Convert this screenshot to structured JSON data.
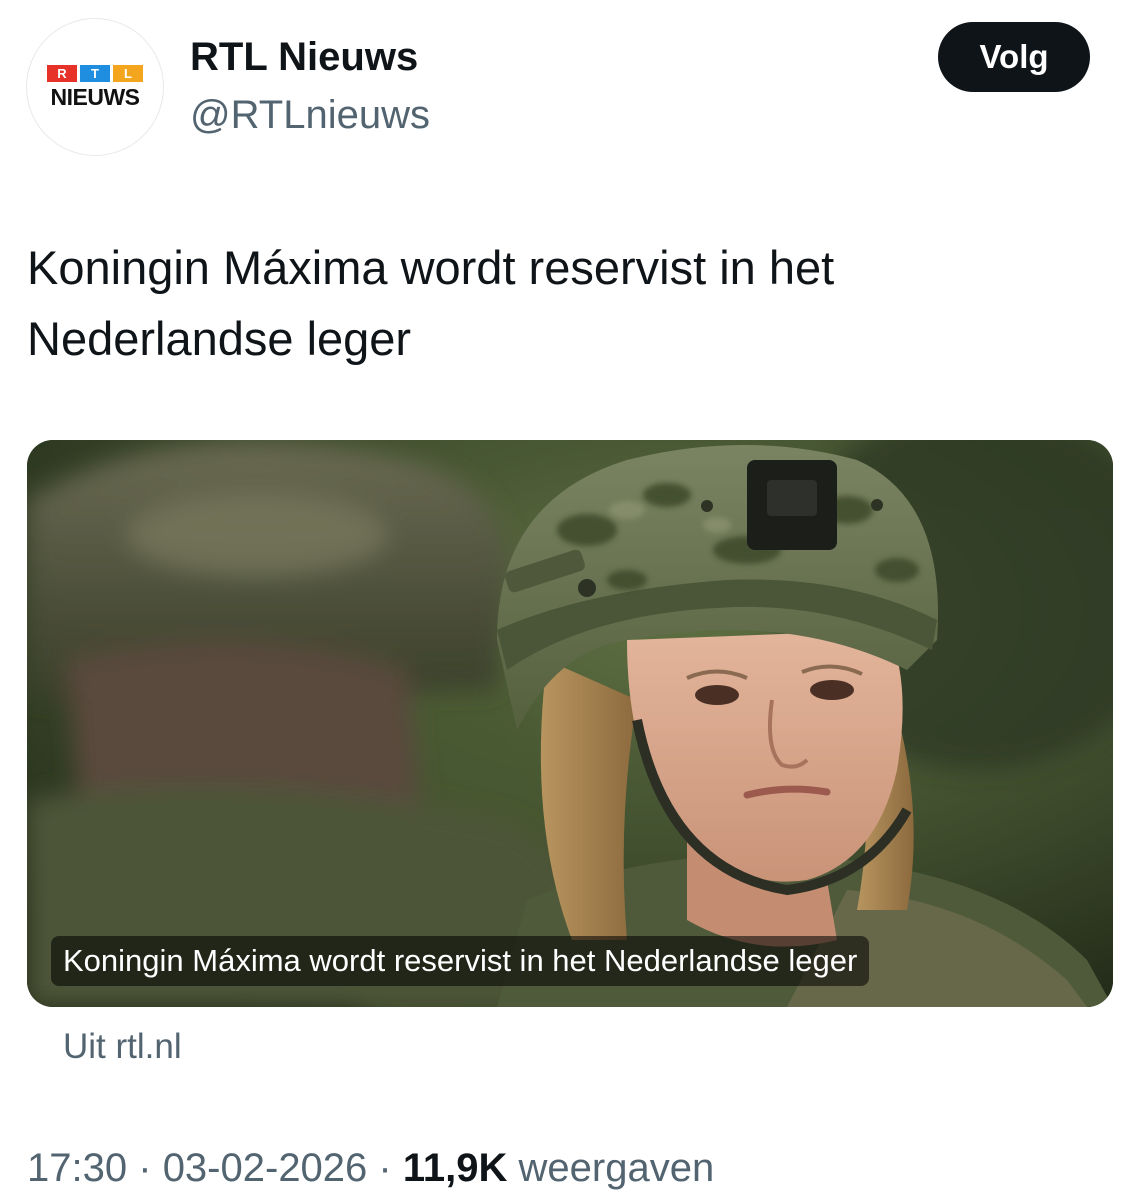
{
  "account": {
    "avatar_logo_letters": [
      "R",
      "T",
      "L"
    ],
    "avatar_logo_word": "NIEUWS",
    "name": "RTL Nieuws",
    "handle": "@RTLnieuws"
  },
  "follow_button": {
    "label": "Volg"
  },
  "tweet": {
    "text_line1": "Koningin Máxima wordt reservist in het",
    "text_line2": "Nederlandse leger"
  },
  "media": {
    "caption": "Koningin Máxima wordt reservist in het Nederlandse leger",
    "source": "Uit rtl.nl"
  },
  "meta": {
    "time": "17:30",
    "separator": "·",
    "date": "03-02-2026",
    "views_count": "11,9K",
    "views_label": "weergaven"
  },
  "colors": {
    "text_primary": "#0f1419",
    "text_secondary": "#536471",
    "follow_button_bg": "#0f1419",
    "logo_red": "#e63228",
    "logo_blue": "#1f8de0",
    "logo_yellow": "#f3a51d"
  }
}
